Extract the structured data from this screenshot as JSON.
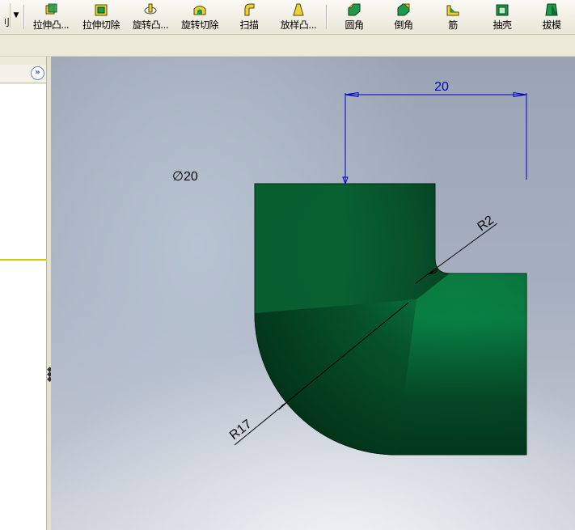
{
  "toolbar": {
    "clipped_label": "刂",
    "buttons": [
      {
        "label": "拉伸凸...",
        "icon": "extrude-boss-icon"
      },
      {
        "label": "拉伸切除",
        "icon": "extrude-cut-icon"
      },
      {
        "label": "旋转凸...",
        "icon": "revolve-boss-icon"
      },
      {
        "label": "旋转切除",
        "icon": "revolve-cut-icon"
      },
      {
        "label": "扫描",
        "icon": "sweep-icon"
      },
      {
        "label": "放样凸...",
        "icon": "loft-boss-icon"
      },
      {
        "label": "圆角",
        "icon": "fillet-icon"
      },
      {
        "label": "倒角",
        "icon": "chamfer-icon"
      },
      {
        "label": "筋",
        "icon": "rib-icon"
      },
      {
        "label": "抽壳",
        "icon": "shell-icon"
      },
      {
        "label": "拔模",
        "icon": "draft-icon"
      }
    ]
  },
  "left_pane": {
    "expand_glyph": "»"
  },
  "viewport": {
    "dimensions": {
      "diameter": "∅20",
      "horizontal": "20",
      "radius_small": "R2",
      "radius_large": "R17"
    },
    "colors": {
      "part": "#00703c",
      "part_dark": "#003a1f",
      "dimension_blue": "#0000c8",
      "dimension_black": "#000000"
    }
  }
}
